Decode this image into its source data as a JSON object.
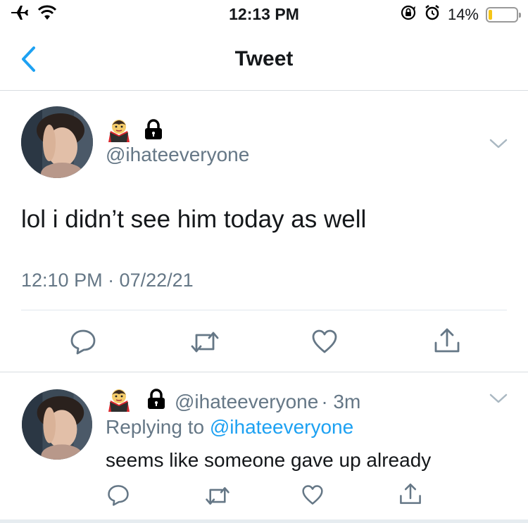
{
  "status_bar": {
    "time": "12:13 PM",
    "battery_percent": "14%",
    "battery_level": 0.14,
    "icons": [
      "airplane-icon",
      "wifi-icon",
      "rotation-lock-icon",
      "alarm-icon",
      "battery-icon"
    ]
  },
  "nav": {
    "title": "Tweet",
    "back_icon": "chevron-left-icon"
  },
  "tweet": {
    "emojis": [
      "vampire-emoji",
      "lock-icon"
    ],
    "handle": "@ihateeveryone",
    "text": "lol i didn’t see him today as well",
    "timestamp": "12:10 PM · 07/22/21",
    "actions": [
      "reply-icon",
      "retweet-icon",
      "like-icon",
      "share-icon"
    ]
  },
  "reply": {
    "handle": "@ihateeveryone",
    "time_ago": "· 3m",
    "replying_prefix": "Replying to",
    "replying_to": "@ihateeveryone",
    "text": "seems like someone gave up already"
  },
  "colors": {
    "accent": "#1da1f2",
    "secondary_text": "#657786",
    "icon_gray": "#657786",
    "battery": "#f5c518"
  }
}
